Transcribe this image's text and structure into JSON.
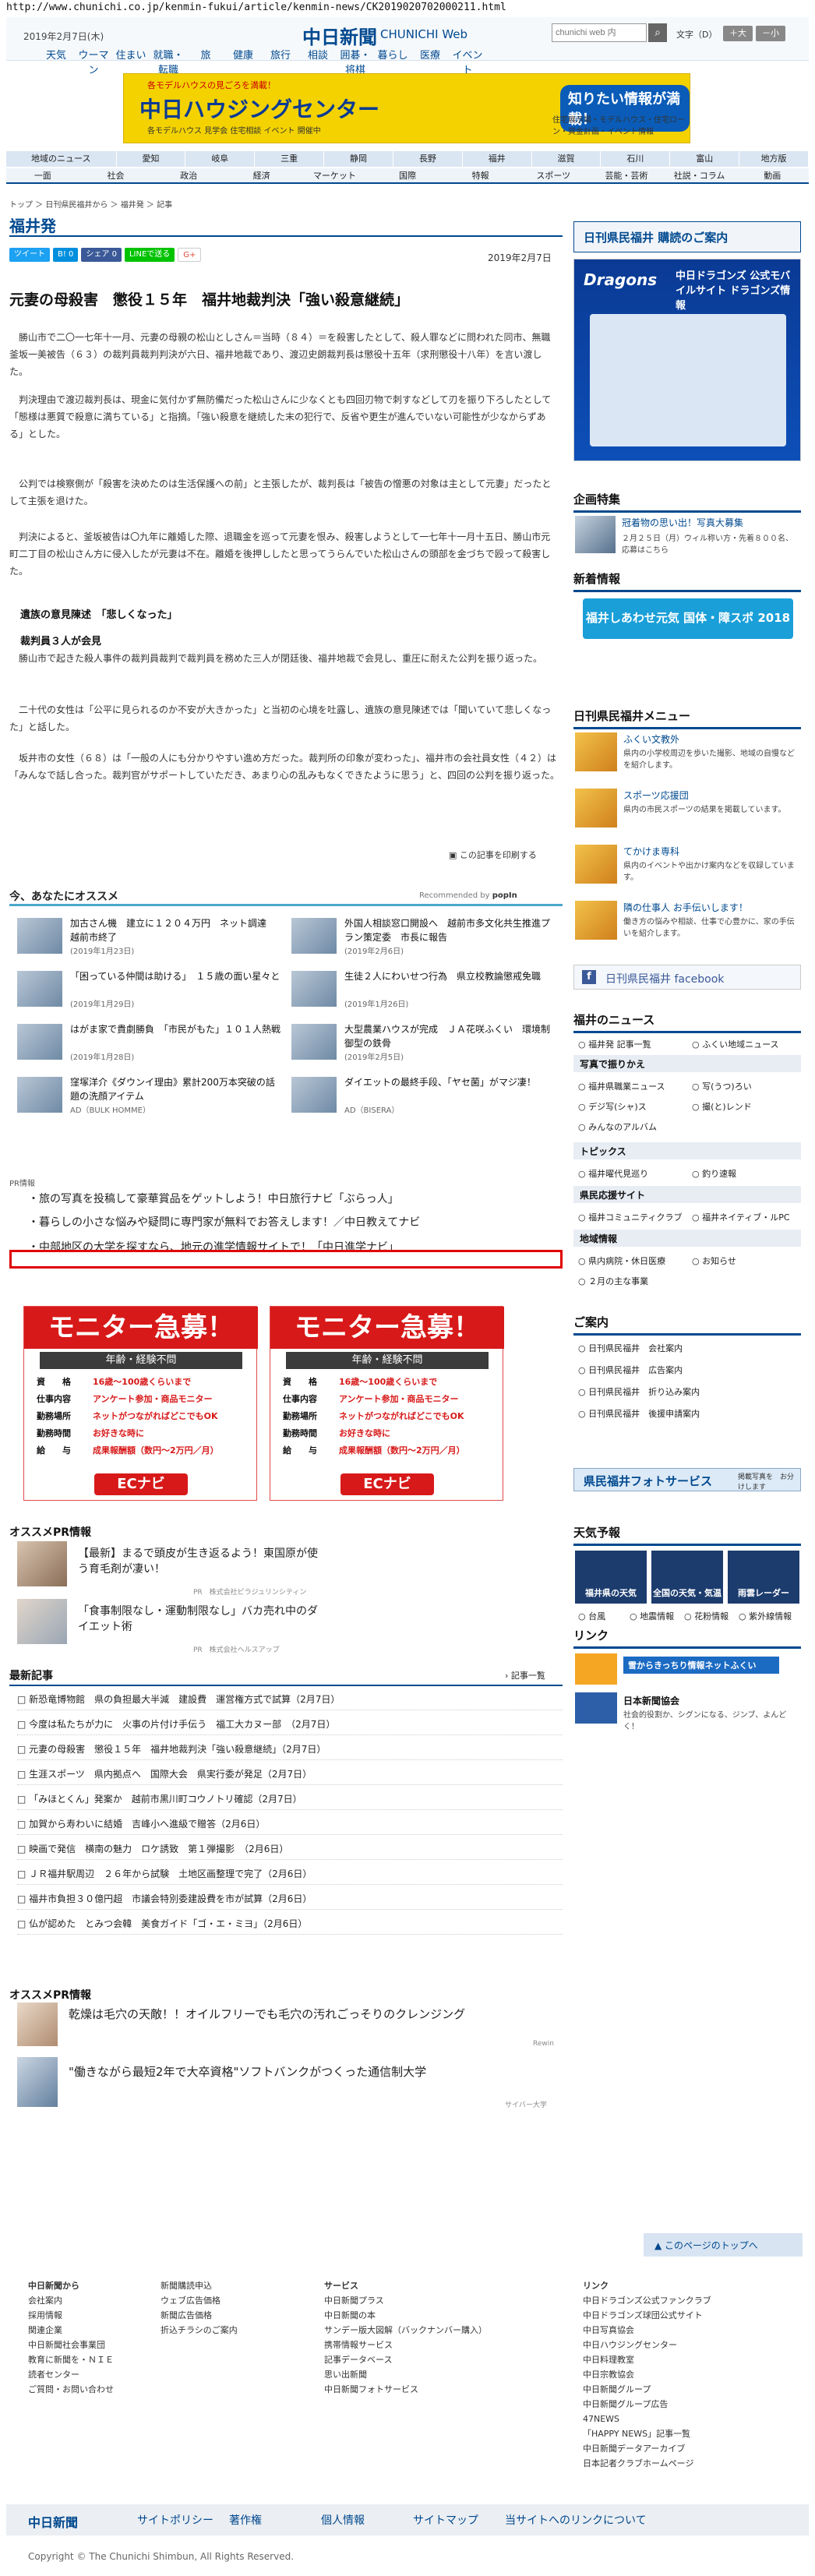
{
  "browser": {
    "url": "http://www.chunichi.co.jp/kenmin-fukui/article/kenmin-news/CK2019020702000211.html"
  },
  "header": {
    "date": "2019年2月7日(木)",
    "logo": "中日新聞",
    "logo_sub": "CHUNICHI Web",
    "search_placeholder": "chunichi web 内",
    "search_icon": "search-icon",
    "font_size_label": "文字（D）",
    "font_large": "＋大",
    "font_small": "－小",
    "nav": [
      "天気",
      "ウーマン",
      "住まい",
      "就職・転職",
      "旅",
      "健康",
      "旅行",
      "相談",
      "囲碁・将棋",
      "暮らし",
      "医療",
      "イベント"
    ]
  },
  "banner": {
    "top_note": "各モデルハウスの見ごろを満載！",
    "title": "中日ハウジングセンター",
    "sub": "各モデルハウス 見学会 住宅相談 イベント 開催中",
    "badge": "知りたい情報が満載！",
    "note": "住宅展示場・モデルハウス・住宅ローン・資金計画・イベント情報"
  },
  "nav1": [
    "地域のニュース",
    "愛知",
    "岐阜",
    "三重",
    "静岡",
    "長野",
    "福井",
    "滋賀",
    "石川",
    "富山",
    "地方版"
  ],
  "nav2": [
    "一面",
    "社会",
    "政治",
    "経済",
    "マーケット",
    "国際",
    "特報",
    "スポーツ",
    "芸能・芸術",
    "社説・コラム",
    "動画"
  ],
  "breadcrumb": "トップ ＞ 日刊県民福井から ＞ 福井発 ＞ 記事",
  "section_title": "福井発",
  "share": {
    "tweet": "ツイート",
    "b": "B! 0",
    "fb": "シェア 0",
    "line": "LINEで送る",
    "gplus": "G+"
  },
  "article": {
    "date": "2019年2月7日",
    "title": "元妻の母殺害　懲役１５年　福井地裁判決「強い殺意継続」",
    "p1": "勝山市で二〇一七年十一月、元妻の母親の松山としさん＝当時（８４）＝を殺害したとして、殺人罪などに問われた同市、無職釜坂一美被告（６３）の裁判員裁判判決が六日、福井地裁であり、渡辺史朗裁判長は懲役十五年（求刑懲役十八年）を言い渡した。",
    "p2": "判決理由で渡辺裁判長は、現金に気付かず無防備だった松山さんに少なくとも四回刃物で刺すなどして刃を振り下ろしたとして「態様は悪質で殺意に満ちている」と指摘。「強い殺意を継続した末の犯行で、反省や更生が進んでいない可能性が少なからずある」とした。",
    "p3": "公判では検察側が「殺害を決めたのは生活保護への前」と主張したが、裁判長は「被告の憎悪の対象は主として元妻」だったとして主張を退けた。",
    "p4": "判決によると、釜坂被告は〇九年に離婚した際、退職金を巡って元妻を恨み、殺害しようとして一七年十一月十五日、勝山市元町二丁目の松山さん方に侵入したが元妻は不在。離婚を後押ししたと思ってうらんでいた松山さんの頭部を金づちで殴って殺害した。",
    "sub1": "遺族の意見陳述　「悲しくなった」",
    "sub2": "裁判員３人が会見",
    "p5": "勝山市で起きた殺人事件の裁判員裁判で裁判員を務めた三人が閉廷後、福井地裁で会見し、重圧に耐えた公判を振り返った。",
    "p6": "二十代の女性は「公平に見られるのか不安が大きかった」と当初の心境を吐露し、遺族の意見陳述では「聞いていて悲しくなった」と話した。",
    "p7": "坂井市の女性（６８）は「一般の人にも分かりやすい進め方だった。裁判所の印象が変わった」、福井市の会社員女性（４２）は「みんなで話し合った。裁判官がサポートしていただき、あまり心の乱みもなくできたように思う」と、四回の公判を振り返った。",
    "print": "この記事を印刷する"
  },
  "recommend": {
    "title": "今、あなたにオススメ",
    "by": "Recommended by",
    "brand": "popIn",
    "items": [
      {
        "title": "加古さん機　建立に１２０４万円　ネット調達　越前市終了",
        "date": "(2019年1月23日)"
      },
      {
        "title": "外国人相談窓口開設へ　越前市多文化共生推進プラン策定委　市長に報告",
        "date": "(2019年2月6日)"
      },
      {
        "title": "「困っている仲間は助ける」　１５歳の面い星々と",
        "date": "(2019年1月29日)"
      },
      {
        "title": "生徒２人にわいせつ行為　県立校教論懲戒免職",
        "date": "(2019年1月26日)"
      },
      {
        "title": "はがま家で貴劇勝負　「市民がもた」１０１人熱戦",
        "date": "(2019年1月28日)"
      },
      {
        "title": "大型農業ハウスが完成　ＪＡ花咲ふくい　環境制御型の鉄骨",
        "date": "(2019年2月5日)"
      },
      {
        "title": "窪塚洋介《ダウンイ理由》累計200万本突破の話題の洗顔アイテム",
        "date": "AD（BULK HOMME）"
      },
      {
        "title": "ダイエットの最終手段、「ヤセ菌」がマジ凄！",
        "date": "AD（BISERA）"
      }
    ]
  },
  "pr": {
    "label": "PR情報",
    "links": [
      "旅の写真を投稿して豪華賞品をゲットしよう！中日旅行ナビ「ぶらっ人」",
      "暮らしの小さな悩みや疑問に専門家が無料でお答えします！／中日教えてナビ",
      "中部地区の大学を探すなら、地元の進学情報サイトで！「中日進学ナビ」"
    ]
  },
  "monitor": {
    "head": "モニター急募！",
    "sub": "年齢・経験不問",
    "rows": [
      {
        "k": "資　　格",
        "v": "16歳～100歳くらいまで"
      },
      {
        "k": "仕事内容",
        "v": "アンケート参加・商品モニター"
      },
      {
        "k": "勤務場所",
        "v": "ネットがつながればどこでもOK"
      },
      {
        "k": "勤務時間",
        "v": "お好きな時に"
      },
      {
        "k": "給　　与",
        "v": "成果報酬額（数円～2万円／月）"
      }
    ],
    "logo": "ECナビ"
  },
  "osusume_pr": {
    "title": "オススメPR情報",
    "items": [
      {
        "text": "【最新】まるで頭皮が生き返るよう！東国原が使う育毛剤が凄い！",
        "pr": "PR　株式会社ビラジュリンシティン"
      },
      {
        "text": "「食事制限なし・運動制限なし」バカ売れ中のダイエット術",
        "pr": "PR　株式会社ヘルスアップ"
      }
    ]
  },
  "latest": {
    "title": "最新記事",
    "list_link": "記事一覧",
    "items": [
      "新恐竜博物館　県の負担最大半減　建設費　運営権方式で試算（2月7日）",
      "今度は私たちが力に　火事の片付け手伝う　福工大カヌー部　（2月7日）",
      "元妻の母殺害　懲役１５年　福井地裁判決「強い殺意継続」（2月7日）",
      "生涯スポーツ　県内拠点へ　国際大会　県実行委が発足（2月7日）",
      "「みほとくん」発案か　越前市黒川町コウノトリ確認（2月7日）",
      "加賀から寿わいに結婚　吉峰小へ進級で贈答（2月6日）",
      "映画で発信　横南の魅力　ロケ誘致　第１弾撮影　（2月6日）",
      "ＪＲ福井駅周辺　２６年から試験　土地区画整理で完了（2月6日）",
      "福井市負担３０億円超　市議会特別委建設費を市が試算（2月6日）",
      "仏が認めた　とみつ会韓　美食ガイド「ゴ・エ・ミヨ」（2月6日）"
    ]
  },
  "osusume_pr2": {
    "title": "オススメPR情報",
    "items": [
      {
        "text": "乾燥は毛穴の天敵！！オイルフリーでも毛穴の汚れごっそりのクレンジング",
        "pr": "Rewin"
      },
      {
        "text": "\"働きながら最短2年で大卒資格\"ソフトバンクがつくった通信制大学",
        "pr": "サイバー大学"
      }
    ]
  },
  "sidebar": {
    "kenmin_head": "日刊県民福井 購読のご案内",
    "dragons_title": "中日ドラゴンズ 公式モバイルサイト ドラゴンズ情報",
    "kikaku": "企画特集",
    "kikaku_text": "冠着物の思い出！写真大募集",
    "kikaku_note": "２月２５日（月）ウィル称い方・先着８００名、応募はこちら",
    "shinchaku": "新着情報",
    "shinchaku_badge": "福井しあわせ元気 国体・障スポ 2018",
    "menu_title": "日刊県民福井メニュー",
    "menu": [
      {
        "t": "ふくい文教外",
        "d": "県内の小学校周辺を歩いた撮影、地域の自慢などを紹介します。"
      },
      {
        "t": "スポーツ応援団",
        "d": "県内の市民スポーツの結果を掲載しています。"
      },
      {
        "t": "てかけま専科",
        "d": "県内のイベントや出かけ案内などを収録しています。"
      },
      {
        "t": "隣の仕事人 お手伝いします！",
        "d": "働き方の悩みや相談、仕事で心豊かに、家の手伝いを紹介します。"
      }
    ],
    "fb": "日刊県民福井 facebook",
    "fukui_news": "福井のニュース",
    "fn1": "福井発 記事一覧",
    "fn2": "ふくい地域ニュース",
    "shashin": "写真で振りかえ",
    "sh": [
      "福井県職業ニュース",
      "写(うつ)ろい",
      "デジ写(シャ)ス",
      "撮(と)レンド",
      "みんなのアルバム"
    ],
    "topics": "トピックス",
    "tp": [
      "福井曜代見巡り",
      "釣り速報"
    ],
    "kenmin_links": "県民応援サイト",
    "kl": [
      "福井コミュニティクラブ",
      "福井ネイティブ・ルPC"
    ],
    "chiiki": "地域情報",
    "ch": [
      "県内病院・休日医療",
      "お知らせ",
      "２月の主な事業"
    ],
    "goannai": "ご案内",
    "ga": [
      "日刊県民福井　会社案内",
      "日刊県民福井　広告案内",
      "日刊県民福井　折り込み案内",
      "日刊県民福井　後援申請案内"
    ],
    "photo_service": "県民福井フォトサービス",
    "photo_note": "掲載写真を　お分けします",
    "tenki": "天気予報",
    "tk": [
      "福井県の天気",
      "全国の天気・気温",
      "雨雲レーダー"
    ],
    "tk_links": [
      "台風",
      "地震情報",
      "花粉情報",
      "紫外線情報"
    ],
    "link": "リンク",
    "link1": "雪からきっちり情報ネットふくい",
    "link2": "日本新聞協会",
    "link2_note": "社会的役割か、シグンになる、ジンブ、よんどく！",
    "pagetop": "このページのトップへ"
  },
  "footer": {
    "col1": [
      "中日新聞から",
      "会社案内",
      "採用情報",
      "関連企業",
      "中日新聞社会事業団",
      "教育に新聞を・ＮＩＥ",
      "読者センター",
      "ご質問・お問い合わせ"
    ],
    "col2": [
      "",
      "新聞購読申込",
      "ウェブ広告価格",
      "新聞広告価格",
      "折込チラシのご案内"
    ],
    "col3": [
      "サービス",
      "中日新聞プラス",
      "中日新聞の本",
      "サンデー版大図解（バックナンバー購入）",
      "携帯情報サービス",
      "記事データベース",
      "思い出新聞",
      "中日新聞フォトサービス"
    ],
    "col4": [
      "リンク",
      "中日ドラゴンズ公式ファンクラブ",
      "中日ドラゴンズ球団公式サイト",
      "中日写真協会",
      "中日ハウジングセンター",
      "中日料理教室",
      "中日宗教協会",
      "中日新聞グループ",
      "中日新聞グループ広告",
      "47NEWS",
      "「HAPPY NEWS」記事一覧",
      "中日新聞データアーカイブ",
      "日本記者クラブホームページ"
    ],
    "bar": [
      "中日新聞",
      "サイトポリシー",
      "著作権",
      "個人情報",
      "サイトマップ",
      "当サイトへのリンクについて"
    ],
    "copyright": "Copyright © The Chunichi Shimbun, All Rights Reserved."
  }
}
